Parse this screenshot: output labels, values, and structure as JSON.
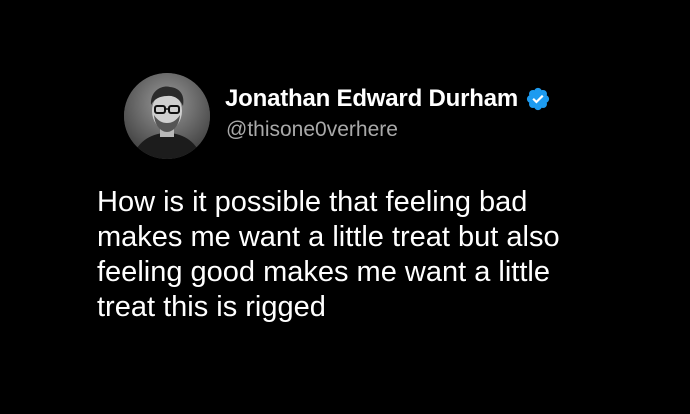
{
  "colors": {
    "background": "#000000",
    "name": "#ffffff",
    "handle": "#a9a9a9",
    "verified_badge": "#1d9bf0"
  },
  "author": {
    "display_name": "Jonathan Edward Durham",
    "handle": "@thisone0verhere",
    "verified": true,
    "verified_icon": "verified-badge-icon",
    "avatar": "profile-photo-grayscale"
  },
  "tweet": {
    "lines": [
      "How is it possible that feeling bad",
      "makes me want a little treat but also",
      "feeling good makes me want a little",
      "treat this is rigged"
    ]
  }
}
